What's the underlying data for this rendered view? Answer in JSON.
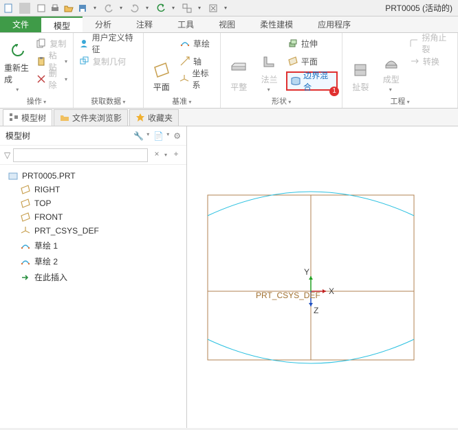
{
  "window": {
    "title": "PRT0005 (活动的)"
  },
  "qat": {
    "items": [
      "file-icon",
      "new-icon",
      "print-icon",
      "open-icon",
      "save-icon",
      "undo-icon",
      "redo-icon",
      "regen-icon",
      "windows-icon",
      "close-icon"
    ]
  },
  "ribbon": {
    "tabs": {
      "file": "文件",
      "list": [
        "模型",
        "分析",
        "注释",
        "工具",
        "视图",
        "柔性建模",
        "应用程序"
      ],
      "active_index": 0
    },
    "groups": {
      "operate": {
        "label": "操作",
        "regenerate": "重新生成",
        "copy": "复制",
        "paste": "粘贴",
        "delete": "删除"
      },
      "getdata": {
        "label": "获取数据",
        "user_feature": "用户定义特征",
        "copy_geom": "复制几何"
      },
      "datum": {
        "label": "基准",
        "plane": "平面",
        "sketch": "草绘",
        "axis": "轴",
        "csys": "坐标系"
      },
      "shape": {
        "label": "形状",
        "flatten": "平整",
        "flange": "法兰",
        "extrude": "拉伸",
        "plane": "平面",
        "boundary_blend": "边界混合",
        "badge": "1"
      },
      "engineering": {
        "label": "工程",
        "split": "扯裂",
        "form": "成型",
        "corner_relief": "拐角止裂",
        "convert": "转换"
      }
    }
  },
  "panel_tabs": {
    "model_tree": "模型树",
    "file_browser": "文件夹浏览影",
    "favorites": "收藏夹"
  },
  "model_tree": {
    "title": "模型树",
    "filter_placeholder": "",
    "items": [
      {
        "icon": "part",
        "label": "PRT0005.PRT",
        "child": false
      },
      {
        "icon": "plane",
        "label": "RIGHT",
        "child": true
      },
      {
        "icon": "plane",
        "label": "TOP",
        "child": true
      },
      {
        "icon": "plane",
        "label": "FRONT",
        "child": true
      },
      {
        "icon": "csys",
        "label": "PRT_CSYS_DEF",
        "child": true
      },
      {
        "icon": "sketch",
        "label": "草绘 1",
        "child": true
      },
      {
        "icon": "sketch",
        "label": "草绘 2",
        "child": true
      },
      {
        "icon": "insert",
        "label": "在此插入",
        "child": true
      }
    ]
  },
  "viewport": {
    "csys_label": "PRT_CSYS_DEF",
    "axes": {
      "x": "X",
      "y": "Y",
      "z": "Z"
    }
  }
}
